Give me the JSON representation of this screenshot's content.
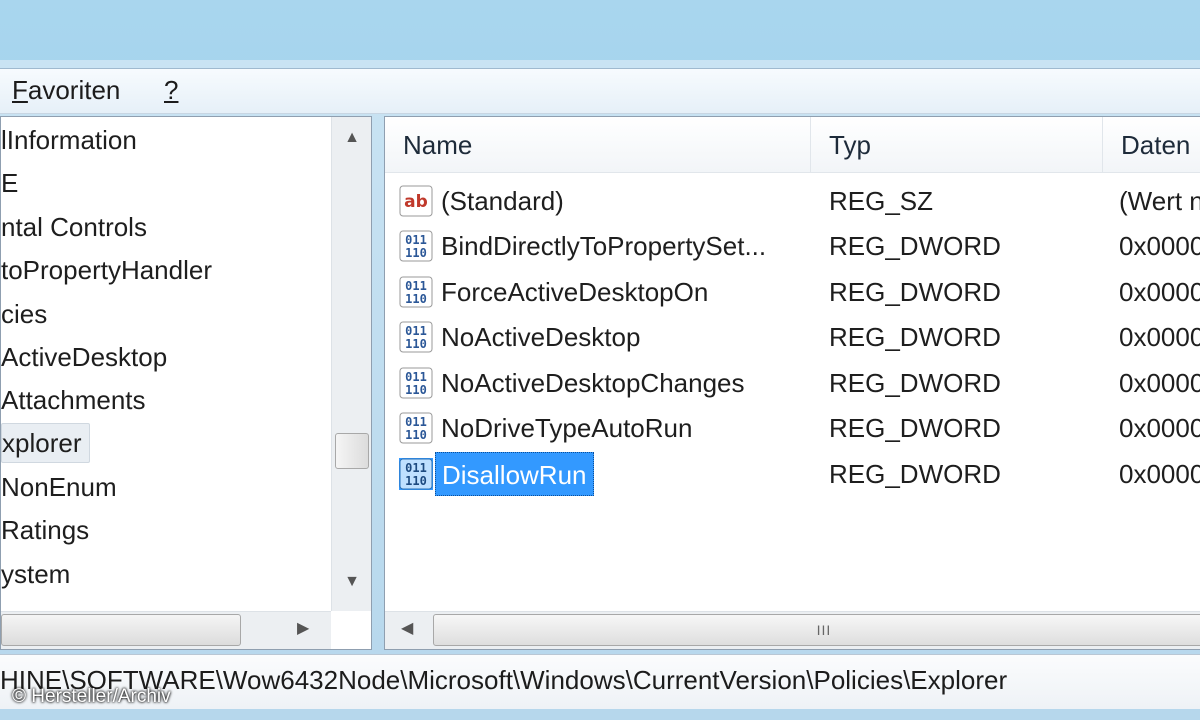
{
  "menubar": {
    "favorites": {
      "first": "F",
      "rest": "avoriten"
    },
    "help": "?"
  },
  "tree": {
    "items": [
      {
        "label": "lInformation"
      },
      {
        "label": "E"
      },
      {
        "label": "ntal Controls"
      },
      {
        "label": "toPropertyHandler"
      },
      {
        "label": "cies"
      },
      {
        "label": "ActiveDesktop"
      },
      {
        "label": "Attachments"
      },
      {
        "label": "xplorer"
      },
      {
        "label": "NonEnum"
      },
      {
        "label": "Ratings"
      },
      {
        "label": "ystem"
      }
    ],
    "selected_index": 7
  },
  "list": {
    "columns": {
      "name": "Name",
      "type": "Typ",
      "data": "Daten"
    },
    "rows": [
      {
        "name": "(Standard)",
        "type": "REG_SZ",
        "data": "(Wert n",
        "icon": "string-value-icon"
      },
      {
        "name": "BindDirectlyToPropertySet...",
        "type": "REG_DWORD",
        "data": "0x0000",
        "icon": "binary-value-icon"
      },
      {
        "name": "ForceActiveDesktopOn",
        "type": "REG_DWORD",
        "data": "0x0000",
        "icon": "binary-value-icon"
      },
      {
        "name": "NoActiveDesktop",
        "type": "REG_DWORD",
        "data": "0x0000",
        "icon": "binary-value-icon"
      },
      {
        "name": "NoActiveDesktopChanges",
        "type": "REG_DWORD",
        "data": "0x0000",
        "icon": "binary-value-icon"
      },
      {
        "name": "NoDriveTypeAutoRun",
        "type": "REG_DWORD",
        "data": "0x0000",
        "icon": "binary-value-icon"
      },
      {
        "name": "DisallowRun",
        "type": "REG_DWORD",
        "data": "0x0000",
        "icon": "binary-value-icon"
      }
    ],
    "selected_index": 6,
    "scroll_thumb_label": "III"
  },
  "status": {
    "path": "HINE\\SOFTWARE\\Wow6432Node\\Microsoft\\Windows\\CurrentVersion\\Policies\\Explorer"
  },
  "credit": "© Hersteller/Archiv",
  "colors": {
    "selection": "#3399ff",
    "string_icon": "#c0392b",
    "binary_icon": "#2b5797"
  }
}
